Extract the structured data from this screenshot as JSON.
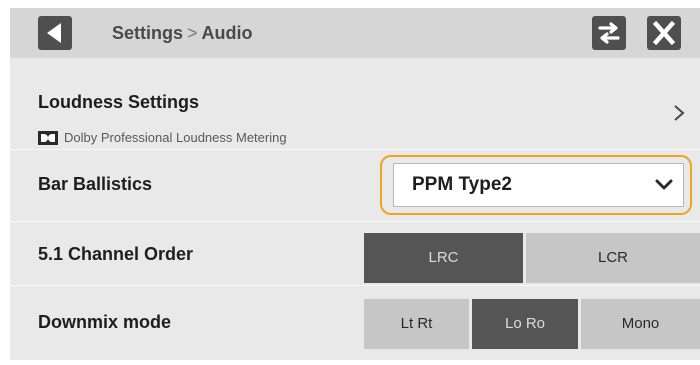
{
  "header": {
    "breadcrumb_parent": "Settings",
    "breadcrumb_separator": ">",
    "breadcrumb_current": "Audio",
    "back_icon": "triangle-left-icon",
    "swap_icon": "swap-arrows-icon",
    "close_icon": "close-x-icon"
  },
  "loudness": {
    "title": "Loudness Settings",
    "subtitle": "Dolby Professional Loudness Metering",
    "logo_icon": "dolby-logo-icon",
    "chevron_icon": "chevron-right-icon"
  },
  "bar_ballistics": {
    "label": "Bar Ballistics",
    "selected_value": "PPM Type2",
    "chevron_icon": "chevron-down-icon",
    "focus_color": "#f0a31e"
  },
  "channel_order": {
    "label": "5.1 Channel Order",
    "options": [
      "LRC",
      "LCR"
    ],
    "selected": "LRC"
  },
  "downmix": {
    "label": "Downmix mode",
    "options": [
      "Lt Rt",
      "Lo Ro",
      "Mono"
    ],
    "selected": "Lo Ro"
  },
  "colors": {
    "panel_bg": "#e9e9e9",
    "header_bg": "#d6d6d6",
    "selected_segment": "#555555",
    "unselected_segment": "#c6c6c6"
  }
}
